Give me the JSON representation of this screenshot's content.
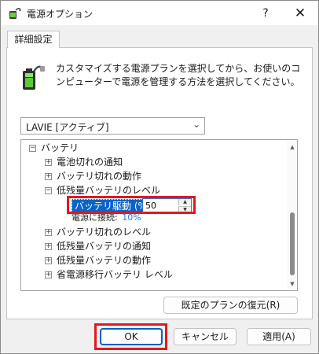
{
  "window": {
    "title": "電源オプション",
    "help_label": "?",
    "close_label": "✕"
  },
  "tab": {
    "label": "詳細設定"
  },
  "description": "カスタマイズする電源プランを選択してから、お使いのコンピューターで電源を管理する方法を選択してください。",
  "plan_select": {
    "value": "LAVIE [アクティブ]"
  },
  "tree": {
    "root": {
      "expander": "⊟",
      "label": "バッテリ"
    },
    "items": [
      {
        "expander": "⊞",
        "label": "電池切れの通知"
      },
      {
        "expander": "⊞",
        "label": "バッテリ切れの動作"
      },
      {
        "expander": "⊟",
        "label": "低残量バッテリのレベル"
      }
    ],
    "setting": {
      "label": "バッテリ駆動 (%):",
      "value": "50",
      "spin_up": "▲",
      "spin_down": "▼"
    },
    "plugged_in": {
      "label": "電源に接続:",
      "value": "10%"
    },
    "items_after": [
      {
        "expander": "⊞",
        "label": "バッテリ切れのレベル"
      },
      {
        "expander": "⊞",
        "label": "低残量バッテリの通知"
      },
      {
        "expander": "⊞",
        "label": "低残量バッテリの動作"
      },
      {
        "expander": "⊞",
        "label": "省電源移行バッテリ レベル"
      }
    ]
  },
  "buttons": {
    "restore_defaults": "既定のプランの復元(R)",
    "ok": "OK",
    "cancel": "キャンセル",
    "apply": "適用(A)"
  },
  "colors": {
    "highlight_box": "#e0191e",
    "selection": "#0a64c8",
    "link_value": "#2a7ae2"
  },
  "icons": {
    "app": "power-options-icon",
    "battery": "battery-plug-icon",
    "chevron": "chevron-down-icon"
  }
}
